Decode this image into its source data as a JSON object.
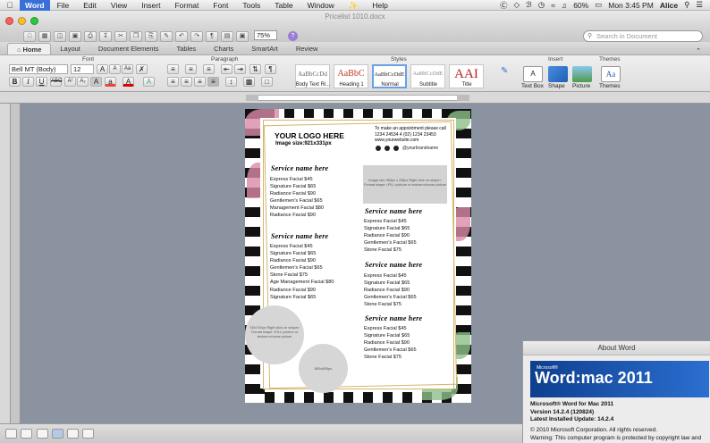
{
  "menubar": {
    "app_name": "Word",
    "items": [
      "File",
      "Edit",
      "View",
      "Insert",
      "Format",
      "Font",
      "Tools",
      "Table",
      "Window",
      "Help"
    ],
    "battery": "60%",
    "clock": "Mon 3:45 PM",
    "user": "Alice"
  },
  "window": {
    "title": "Pricelist 1010.docx",
    "zoom": "75%",
    "search_placeholder": "Search in Document"
  },
  "ribbon_tabs": [
    "Home",
    "Layout",
    "Document Elements",
    "Tables",
    "Charts",
    "SmartArt",
    "Review"
  ],
  "ribbon": {
    "groups": {
      "font": "Font",
      "paragraph": "Paragraph",
      "styles": "Styles",
      "insert": "Insert",
      "themes": "Themes"
    },
    "font_name": "Bell MT (Body)",
    "font_size": "12",
    "styles": [
      {
        "preview": "AaBbCcDd",
        "name": "Body Text Ri..."
      },
      {
        "preview": "AaBbC",
        "name": "Heading 1"
      },
      {
        "preview": "AaBbCcDdE",
        "name": "Normal"
      },
      {
        "preview": "AaBbCcDdE",
        "name": "Subtitle"
      },
      {
        "preview": "AAI",
        "name": "Title"
      }
    ],
    "insert_buttons": [
      "Text Box",
      "Shape",
      "Picture"
    ],
    "themes_button": "Themes"
  },
  "document": {
    "logo_title": "YOUR LOGO HERE",
    "logo_size": "Image size:921x331px",
    "contact": [
      "To make an appointment please call",
      "1234 24534 4 (02) 1234 23453",
      "www.yourwebsite.com"
    ],
    "social_handle": "@yourbrandname",
    "left_sections": [
      {
        "heading": "Service name here",
        "items": [
          "Express Facial $45",
          "Signature Facial $65",
          "Radiance Facial $90",
          "Gentlemen's Facial $65",
          "Management Facial $80",
          "Radiance Facial $90"
        ]
      },
      {
        "heading": "Service name here",
        "items": [
          "Express Facial $45",
          "Signature Facial $65",
          "Radiance Facial $90",
          "Gentlemen's Facial $65",
          " Stone Facial $75",
          " Age Management Facial $80",
          "Radiance Facial $90",
          "Signature Facial $65"
        ]
      }
    ],
    "right_sections": [
      {
        "heading": "Service name here",
        "items": [
          "Express Facial $45",
          "Signature Facial $65",
          "Radiance Facial $90",
          "Gentlemen's Facial $65",
          "Stone Facial $75"
        ]
      },
      {
        "heading": "Service name here",
        "items": [
          "Express Facial $45",
          "Signature Facial $65",
          "Radiance Facial $90",
          "Gentlemen's Facial $65",
          "Stone Facial $75"
        ]
      },
      {
        "heading": "Service name here",
        "items": [
          "Express Facial $45",
          "Signature Facial $65",
          "Radiance Facial $90",
          "Gentlemen's Facial $65",
          "Stone Facial $75"
        ]
      }
    ],
    "image_placeholder": "Image size 565px x 255px Right click on shape> Format shape >FILL>picture or texture>choose picture",
    "circle1_text": "740x740px Right click on shape> Format shape >FILL>picture or texture>choose picture",
    "circle2_text": "800x800px"
  },
  "about_dialog": {
    "title": "About Word",
    "banner_ms": "Microsoft®",
    "banner_product": "Word:mac 2011",
    "product": "Microsoft® Word for Mac 2011",
    "version": "Version 14.2.4 (120824)",
    "update": "Latest Installed Update: 14.2.4",
    "copyright": "© 2010 Microsoft Corporation. All rights reserved.",
    "warning": "Warning: This computer program is protected by copyright law and"
  },
  "colors": {
    "accent": "#3a6fd8",
    "gold": "#d4b66a",
    "leaf_green": "#8fbf8a",
    "pink": "#d88aa8"
  }
}
